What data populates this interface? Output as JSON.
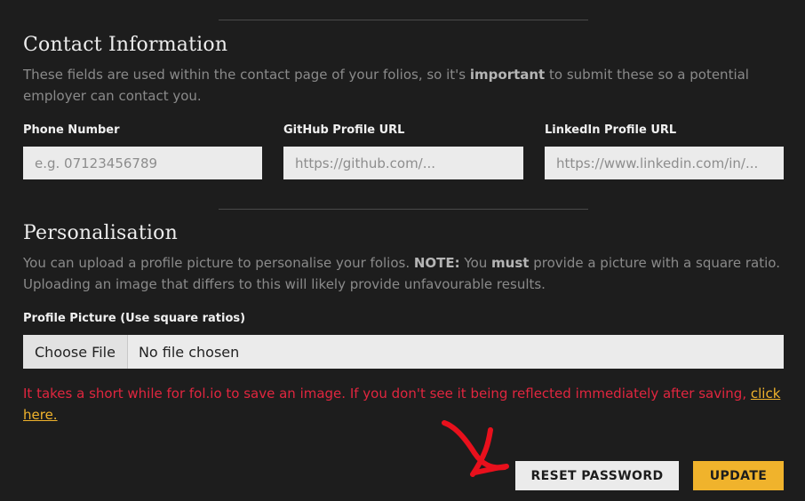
{
  "contact": {
    "title": "Contact Information",
    "desc_part1": "These fields are used within the contact page of your folios, so it's ",
    "desc_bold": "important",
    "desc_part2": " to submit these so a potential employer can contact you.",
    "phone": {
      "label": "Phone Number",
      "placeholder": "e.g. 07123456789",
      "value": ""
    },
    "github": {
      "label": "GitHub Profile URL",
      "placeholder": "https://github.com/...",
      "value": ""
    },
    "linkedin": {
      "label": "LinkedIn Profile URL",
      "placeholder": "https://www.linkedin.com/in/...",
      "value": ""
    }
  },
  "personalisation": {
    "title": "Personalisation",
    "desc_part1": "You can upload a profile picture to personalise your folios. ",
    "desc_note": "NOTE:",
    "desc_part2": " You ",
    "desc_must": "must",
    "desc_part3": " provide a picture with a square ratio. Uploading an image that differs to this will likely provide unfavourable results.",
    "picture_label": "Profile Picture (Use square ratios)",
    "choose_file_label": "Choose File",
    "file_status": "No file chosen"
  },
  "warning": {
    "text": "It takes a short while for fol.io to save an image. If you don't see it being reflected immediately after saving, ",
    "link_text": "click here."
  },
  "actions": {
    "reset_password_label": "RESET PASSWORD",
    "update_label": "UPDATE"
  },
  "colors": {
    "background": "#1d1d1d",
    "accent": "#f0b32c",
    "warning": "#e0263f",
    "annotation": "#e8101c"
  },
  "icons": {
    "annotation": "red-arrow-icon"
  }
}
